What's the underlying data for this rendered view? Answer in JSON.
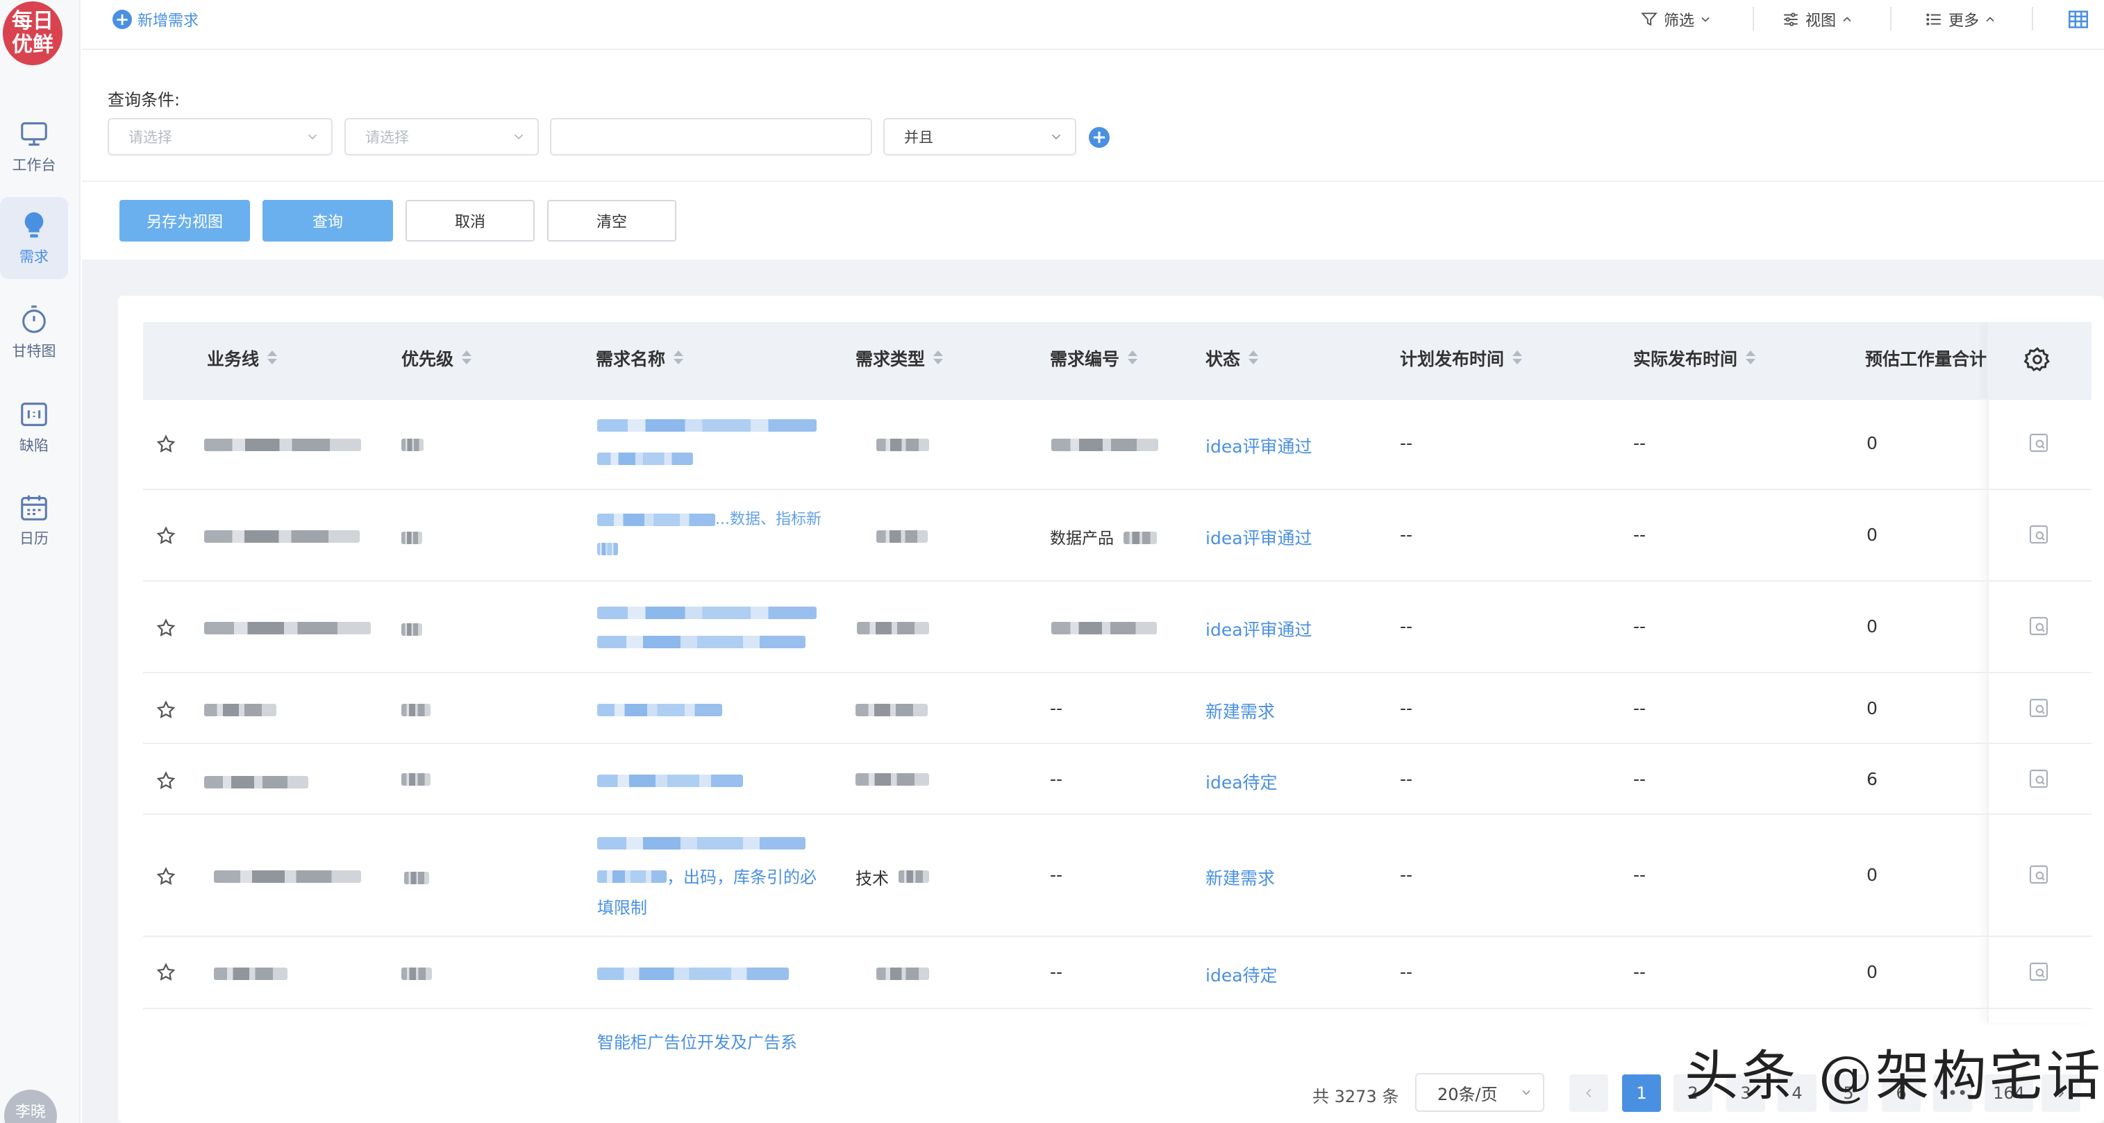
{
  "sidebar": {
    "logo_line1": "每日",
    "logo_line2": "优鲜",
    "items": [
      {
        "label": "工作台",
        "icon": "monitor-icon"
      },
      {
        "label": "需求",
        "icon": "lightbulb-icon"
      },
      {
        "label": "甘特图",
        "icon": "stopwatch-icon"
      },
      {
        "label": "缺陷",
        "icon": "bug-box-icon"
      },
      {
        "label": "日历",
        "icon": "calendar-icon"
      }
    ],
    "avatar_text": "李晓"
  },
  "header": {
    "new_request": "新增需求",
    "filter": "筛选",
    "view": "视图",
    "more": "更多"
  },
  "query": {
    "title": "查询条件:",
    "field1_placeholder": "请选择",
    "field2_placeholder": "请选择",
    "field3_value": "",
    "logic_value": "并且"
  },
  "actions": {
    "save_view": "另存为视图",
    "search": "查询",
    "cancel": "取消",
    "clear": "清空"
  },
  "table": {
    "columns": [
      "业务线",
      "优先级",
      "需求名称",
      "需求类型",
      "需求编号",
      "状态",
      "计划发布时间",
      "实际发布时间",
      "预估工作量合计"
    ],
    "rows": [
      {
        "name_tail": "",
        "type_text": "",
        "code_text": "",
        "status": "idea评审通过",
        "plan": "--",
        "actual": "--",
        "effort": "0"
      },
      {
        "name_tail": "...数据、指标新",
        "type_text": "",
        "code_text": "数据产品",
        "status": "idea评审通过",
        "plan": "--",
        "actual": "--",
        "effort": "0"
      },
      {
        "name_tail": "",
        "type_text": "",
        "code_text": "",
        "status": "idea评审通过",
        "plan": "--",
        "actual": "--",
        "effort": "0"
      },
      {
        "name_tail": "",
        "type_text": "",
        "code_text": "--",
        "status": "新建需求",
        "plan": "--",
        "actual": "--",
        "effort": "0"
      },
      {
        "name_tail": "",
        "type_text": "",
        "code_text": "--",
        "status": "idea待定",
        "plan": "--",
        "actual": "--",
        "effort": "6"
      },
      {
        "name_tail": "，出码，库条引的必",
        "name_line2": "填限制",
        "type_text": "技术",
        "code_text": "--",
        "status": "新建需求",
        "plan": "--",
        "actual": "--",
        "effort": "0"
      },
      {
        "name_tail": "",
        "type_text": "",
        "code_text": "--",
        "status": "idea待定",
        "plan": "--",
        "actual": "--",
        "effort": "0"
      }
    ],
    "partial_row_name": "智能柜广告位开发及广告系"
  },
  "pagination": {
    "total": "共 3273 条",
    "page_size": "20条/页",
    "pages": [
      "1",
      "2",
      "3",
      "4",
      "5",
      "6",
      "•••",
      "164"
    ],
    "current": "1"
  },
  "watermark": "头条 @架构宅话",
  "colors": {
    "accent": "#4a90e2",
    "primary_button": "#6ab0ee",
    "logo": "#d9434f"
  }
}
